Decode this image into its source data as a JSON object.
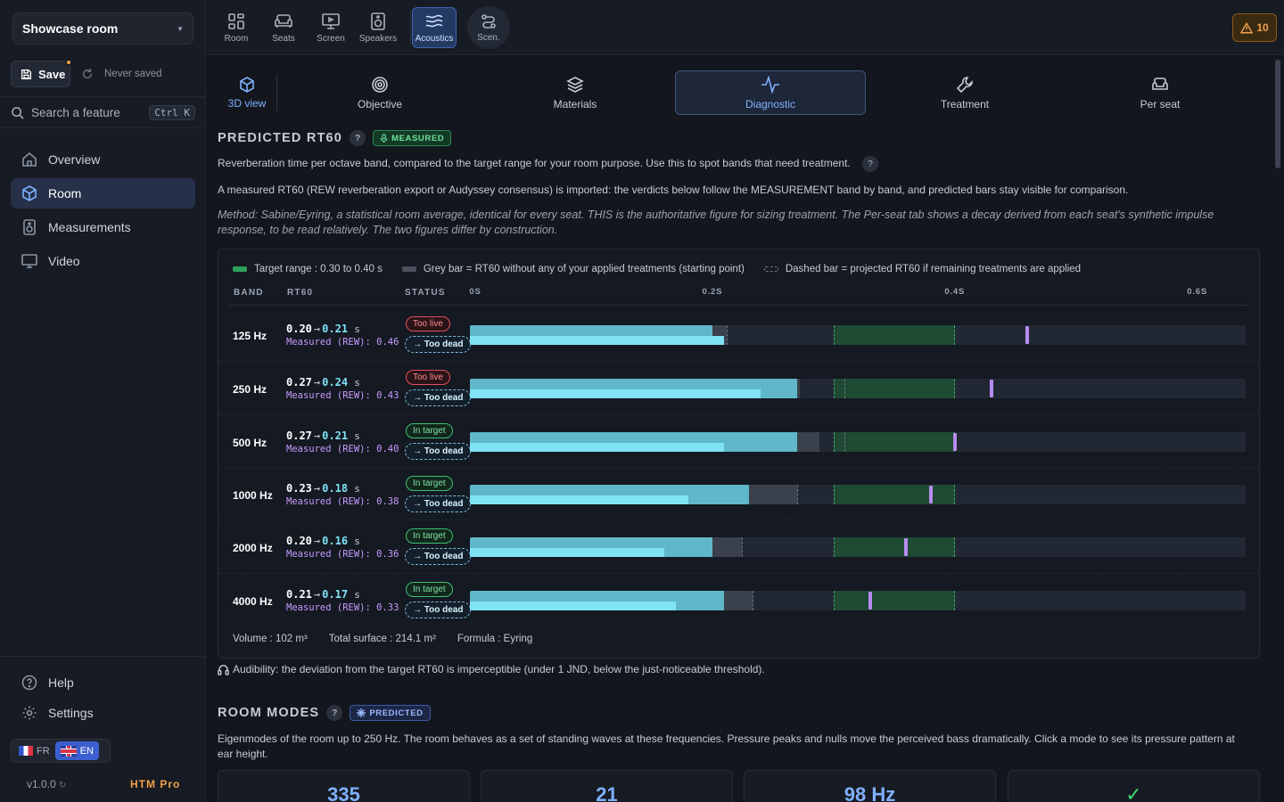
{
  "sidebar": {
    "room_name": "Showcase room",
    "save_label": "Save",
    "save_status": "Never saved",
    "search_placeholder": "Search a feature",
    "search_shortcut": "Ctrl K",
    "nav": [
      {
        "label": "Overview",
        "icon": "home-icon",
        "active": false
      },
      {
        "label": "Room",
        "icon": "cube-icon",
        "active": true
      },
      {
        "label": "Measurements",
        "icon": "speaker-icon",
        "active": false
      },
      {
        "label": "Video",
        "icon": "monitor-icon",
        "active": false
      }
    ],
    "help_label": "Help",
    "settings_label": "Settings",
    "lang_fr": "FR",
    "lang_en": "EN",
    "version": "v1.0.0",
    "plan": "HTM Pro"
  },
  "toolbar": {
    "tools": [
      {
        "label": "Room",
        "icon": "grid-icon"
      },
      {
        "label": "Seats",
        "icon": "sofa-icon"
      },
      {
        "label": "Screen",
        "icon": "screen-icon"
      },
      {
        "label": "Speakers",
        "icon": "speaker-icon"
      },
      {
        "label": "Acoustics",
        "icon": "waves-icon",
        "active": true
      },
      {
        "label": "Scen.",
        "icon": "route-icon"
      }
    ],
    "warning_count": "10"
  },
  "subtabs": {
    "view_label": "3D view",
    "tabs": [
      {
        "label": "Objective",
        "icon": "target-icon"
      },
      {
        "label": "Materials",
        "icon": "layers-icon"
      },
      {
        "label": "Diagnostic",
        "icon": "pulse-icon",
        "active": true
      },
      {
        "label": "Treatment",
        "icon": "wrench-icon"
      },
      {
        "label": "Per seat",
        "icon": "armchair-icon"
      }
    ]
  },
  "rt60": {
    "title": "PREDICTED RT60",
    "badge": "MEASURED",
    "help": "?",
    "desc1": "Reverberation time per octave band, compared to the target range for your room purpose. Use this to spot bands that need treatment.",
    "desc2": "A measured RT60 (REW reverberation export or Audyssey consensus) is imported: the verdicts below follow the MEASUREMENT band by band, and predicted bars stay visible for comparison.",
    "method": "Method: Sabine/Eyring, a statistical room average, identical for every seat. THIS is the authoritative figure for sizing treatment. The Per-seat tab shows a decay derived from each seat's synthetic impulse response, to be read relatively. The two figures differ by construction.",
    "legend": {
      "target": "Target range : 0.30 to 0.40 s",
      "grey": "Grey bar = RT60 without any of your applied treatments (starting point)",
      "dashed": "Dashed bar = projected RT60 if remaining treatments are applied"
    },
    "columns": {
      "band": "BAND",
      "rt60": "RT60",
      "status": "STATUS"
    },
    "axis_ticks": [
      "0S",
      "0.2S",
      "0.4S",
      "0.6S"
    ],
    "arrow": "→",
    "unit": "s",
    "measured_prefix": "Measured (REW): ",
    "rows": [
      {
        "band": "125 Hz",
        "before": "0.20",
        "after": "0.21",
        "measured": "0.46 s",
        "status": "Too live",
        "status_kind": "live",
        "projected": "→ Too dead"
      },
      {
        "band": "250 Hz",
        "before": "0.27",
        "after": "0.24",
        "measured": "0.43 s",
        "status": "Too live",
        "status_kind": "live",
        "projected": "→ Too dead"
      },
      {
        "band": "500 Hz",
        "before": "0.27",
        "after": "0.21",
        "measured": "0.40 s",
        "status": "In target",
        "status_kind": "target",
        "projected": "→ Too dead"
      },
      {
        "band": "1000 Hz",
        "before": "0.23",
        "after": "0.18",
        "measured": "0.38 s",
        "status": "In target",
        "status_kind": "target",
        "projected": "→ Too dead"
      },
      {
        "band": "2000 Hz",
        "before": "0.20",
        "after": "0.16",
        "measured": "0.36 s",
        "status": "In target",
        "status_kind": "target",
        "projected": "→ Too dead"
      },
      {
        "band": "4000 Hz",
        "before": "0.21",
        "after": "0.17",
        "measured": "0.33 s",
        "status": "In target",
        "status_kind": "target",
        "projected": "→ Too dead"
      }
    ],
    "volume": "Volume : 102 m³",
    "surface": "Total surface : 214.1 m²",
    "formula": "Formula : Eyring",
    "audibility": "Audibility: the deviation from the target RT60 is imperceptible (under 1 JND, below the just-noticeable threshold)."
  },
  "chart_data": {
    "type": "bar",
    "title": "PREDICTED RT60",
    "xlabel": "",
    "ylabel": "",
    "xlim": [
      0,
      0.64
    ],
    "target_range": [
      0.3,
      0.4
    ],
    "categories": [
      "125 Hz",
      "250 Hz",
      "500 Hz",
      "1000 Hz",
      "2000 Hz",
      "4000 Hz"
    ],
    "series": [
      {
        "values": [
          0.2,
          0.27,
          0.27,
          0.23,
          0.2,
          0.21
        ]
      },
      {
        "values": [
          0.21,
          0.24,
          0.21,
          0.18,
          0.16,
          0.17
        ]
      },
      {
        "values": [
          0.46,
          0.43,
          0.4,
          0.38,
          0.36,
          0.33
        ]
      }
    ],
    "untreated_values": [
      0.212,
      0.272,
      0.288,
      0.27,
      0.224,
      0.233
    ],
    "projected_values": [
      0.204,
      0.31,
      0.31,
      0.27,
      0.224,
      0.233
    ],
    "grid": false,
    "legend": "top-left"
  },
  "modes": {
    "title": "ROOM MODES",
    "badge": "PREDICTED",
    "help": "?",
    "desc": "Eigenmodes of the room up to 250 Hz. The room behaves as a set of standing waves at these frequencies. Pressure peaks and nulls move the perceived bass dramatically. Click a mode to see its pressure pattern at ear height.",
    "cards": [
      "335",
      "21",
      "98 Hz",
      "✓"
    ]
  },
  "colors": {
    "accent": "#7fb0ff",
    "target_green": "#2ea05a",
    "bar_cyan": "#7fe3f5",
    "measured_purple": "#b78cf0",
    "warning": "#f0a24a"
  }
}
